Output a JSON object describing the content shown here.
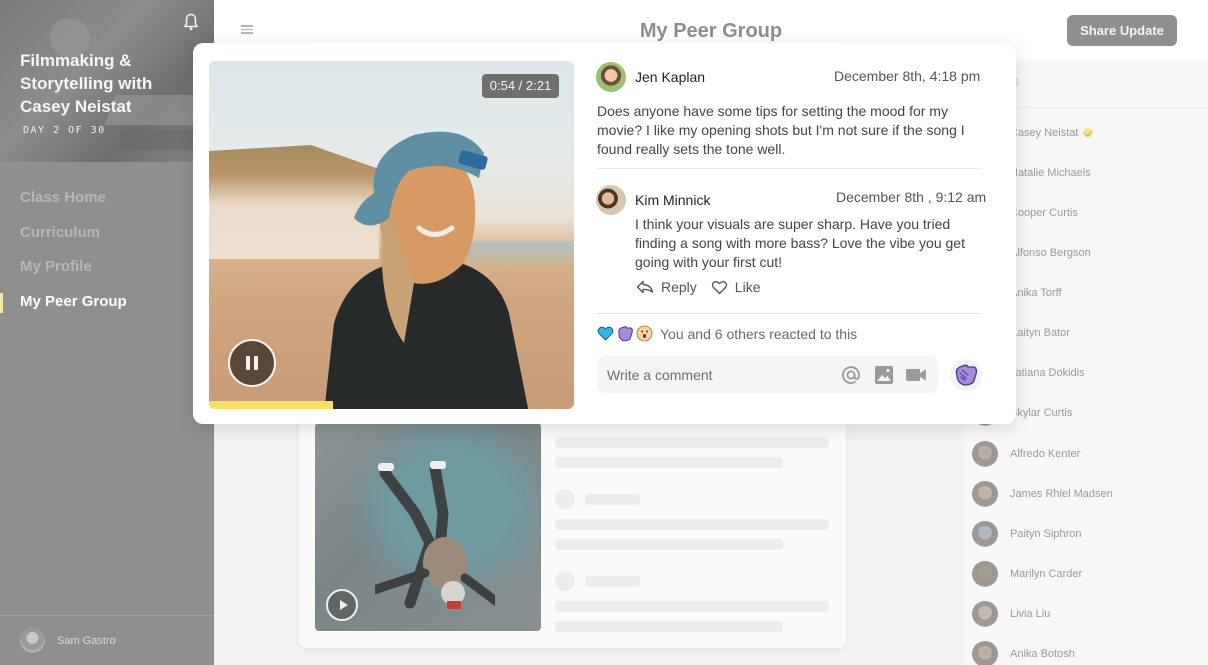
{
  "sidebar": {
    "course_title": "Filmmaking & Storytelling with Casey Neistat",
    "course_progress": "DAY 2 OF 30",
    "nav": [
      {
        "label": "Class Home",
        "active": false
      },
      {
        "label": "Curriculum",
        "active": false
      },
      {
        "label": "My Profile",
        "active": false
      },
      {
        "label": "My Peer Group",
        "active": true
      }
    ],
    "user_name": "Sam Gastro",
    "icons": {
      "notifications": "bell-icon"
    }
  },
  "header": {
    "title": "My Peer Group",
    "share_button": "Share Update",
    "menu_icon": "hamburger-menu-icon"
  },
  "roster": {
    "header_label": "Members",
    "members": [
      {
        "name": "Casey Neistat",
        "verified": true
      },
      {
        "name": "Natalie Michaels"
      },
      {
        "name": "Cooper Curtis"
      },
      {
        "name": "Alfonso Bergson"
      },
      {
        "name": "Anika Torff"
      },
      {
        "name": "Kaityn Bator"
      },
      {
        "name": "Tatiana Dokidis"
      },
      {
        "name": "Skylar Curtis"
      },
      {
        "name": "Alfredo Kenter"
      },
      {
        "name": "James Rhiel Madsen"
      },
      {
        "name": "Paityn Siphron"
      },
      {
        "name": "Marilyn Carder"
      },
      {
        "name": "Livia Liu"
      },
      {
        "name": "Anika Botosh"
      }
    ]
  },
  "modal": {
    "video": {
      "time_display": "0:54 / 2:21",
      "progress": 0.34,
      "state": "playing",
      "colors": {
        "progress": "#f7df6a"
      }
    },
    "post": {
      "author": "Jen Kaplan",
      "timestamp": "December 8th, 4:18 pm",
      "text": "Does anyone have some tips for setting the mood for my movie? I like my opening shots but I'm not sure if the song I found really sets the tone well."
    },
    "reply": {
      "author": "Kim Minnick",
      "timestamp": "December 8th , 9:12 am",
      "text": "I think your visuals are super sharp. Have you tried finding a song with more bass? Love the vibe you get going with your first cut!",
      "reply_label": "Reply",
      "like_label": "Like"
    },
    "reactions": {
      "emojis": [
        "blue-heart",
        "clapping-hands",
        "surprised-face"
      ],
      "summary": "You and 6 others reacted to this"
    },
    "comment": {
      "placeholder": "Write a comment",
      "value": ""
    }
  }
}
